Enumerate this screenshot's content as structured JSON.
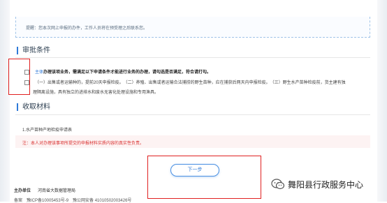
{
  "tip": {
    "text": "提醒：您本次网上申报的办件，工作人员将在预受理之后联系您。"
  },
  "approval": {
    "title": "审批条件",
    "conditions": [
      {
        "prefix": "主体",
        "text": "办理该项业务，需满足以下申请条件才能进行业务的办理，请勾选是否满足，符合请打勾。"
      },
      {
        "line1": "（一）出售或者运输种的，提前20天申报检疫。　（二）养殖、出售或者运输合法捕捞的野生苗种，应在捕获后两天内申报检疫。　（三）野生水产苗种检疫前，货主建有独",
        "line2": "理隔离设施，具有独立的进排水和废水无害化处理设施和专用渔具。"
      }
    ]
  },
  "materials": {
    "title": "收取材料",
    "item": "1.水产苗种产地检疫申请表",
    "warning": "注：本人对办理该事项所提交的申报材料实质内容的真实性负责。"
  },
  "next_button": {
    "label": "下一步"
  },
  "footer": {
    "sponsor_label": "主办单位",
    "sponsor_value": "河南省大数据管理局",
    "icp": "备案　豫ICP备10005453号-9　豫公网安备 41010502003426号"
  },
  "watermark": {
    "icon": "wechat-icon",
    "text": "舞阳县行政服务中心"
  },
  "colors": {
    "accent": "#2f7ad8",
    "highlight_red": "#e02020",
    "warning_text": "#d9302f"
  }
}
